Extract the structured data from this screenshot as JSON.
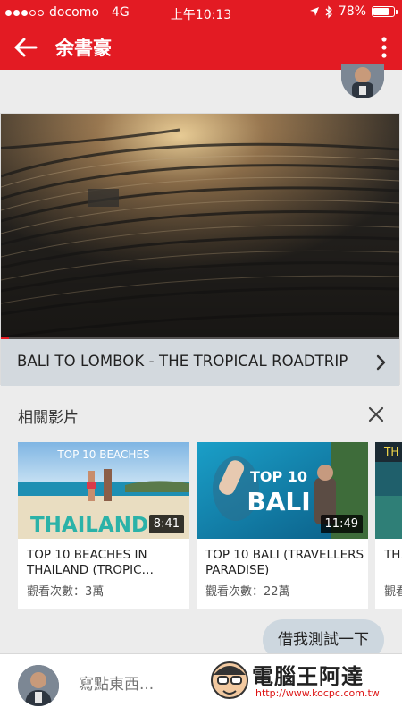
{
  "status_bar": {
    "carrier": "docomo",
    "network": "4G",
    "time": "上午10:13",
    "battery": "78%",
    "battery_level": 0.78,
    "signal_dots_filled": 3,
    "signal_dots_total": 5
  },
  "app_bar": {
    "title": "余書豪",
    "back_icon": "arrow-left-icon",
    "menu_icon": "more-vert-icon",
    "color": "#e31b23"
  },
  "video_card": {
    "title": "BALI TO LOMBOK - THE TROPICAL ROADTRIP",
    "progress": 0.02
  },
  "related": {
    "heading": "相關影片",
    "videos": [
      {
        "thumb_text_top": "TOP 10 BEACHES",
        "thumb_text_main": "THAILAND",
        "duration": "8:41",
        "title": "TOP 10 BEACHES IN THAILAND (TROPIC…",
        "views": "觀看次數：3萬"
      },
      {
        "thumb_text_top": "TOP 10",
        "thumb_text_main": "BALI",
        "duration": "11:49",
        "title": "TOP 10 BALI (TRAVELLERS PARADISE)",
        "views": "觀看次數：22萬"
      },
      {
        "thumb_text_top": "TH",
        "title": "TH… Kh…",
        "views": "觀看"
      }
    ]
  },
  "chat": {
    "message": "借我測試一下"
  },
  "input": {
    "placeholder": "寫點東西..."
  },
  "watermark": {
    "name": "電腦王阿達",
    "url": "http://www.kocpc.com.tw"
  }
}
